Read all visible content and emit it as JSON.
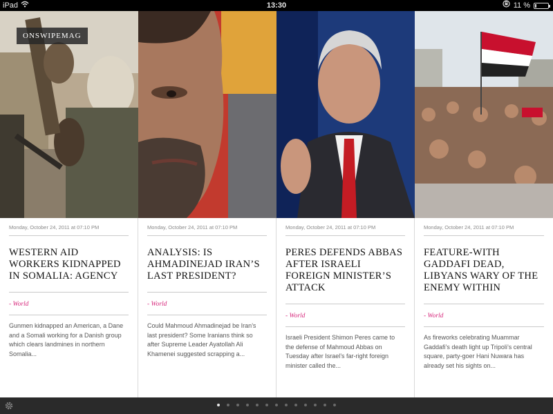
{
  "status_bar": {
    "device": "iPad",
    "time": "13:30",
    "battery": "11 %",
    "battery_level": 0.11,
    "icons": [
      "wifi-icon",
      "orientation-lock-icon",
      "battery-icon"
    ]
  },
  "brand": "ONSWIPEMAG",
  "articles": [
    {
      "date": "Monday, October 24, 2011 at 07:10 PM",
      "title": "Western aid workers kidnapped in Somalia: agency",
      "category": "- World",
      "excerpt": "Gunmen kidnapped an American, a Dane and a Somali working for a Danish group which clears landmines in northern Somalia..."
    },
    {
      "date": "Monday, October 24, 2011 at 07:10 PM",
      "title": "Analysis: Is Ahmadinejad Iran’s last president?",
      "category": "- World",
      "excerpt": "Could Mahmoud Ahmadinejad be Iran’s last president? Some Iranians think so after Supreme Leader Ayatollah Ali Khamenei suggested scrapping a..."
    },
    {
      "date": "Monday, October 24, 2011 at 07:10 PM",
      "title": "Peres defends Abbas after Israeli foreign minister’s attack",
      "category": "- World",
      "excerpt": "Israeli President Shimon Peres came to the defense of Mahmoud Abbas on Tuesday after Israel’s far-right foreign minister called the..."
    },
    {
      "date": "Monday, October 24, 2011 at 07:10 PM",
      "title": "Feature-With Gaddafi dead, Libyans wary of the enemy within",
      "category": "- World",
      "excerpt": "As fireworks celebrating Muammar Gaddafi’s death light up Tripoli’s central square, party-goer Hani Nuwara has already set his sights on..."
    }
  ],
  "pagination": {
    "total_pages": 13,
    "current_page": 1
  },
  "colors": {
    "accent": "#d6257a",
    "bottom_bar": "#2a2a2a",
    "status_bar": "#000000"
  }
}
